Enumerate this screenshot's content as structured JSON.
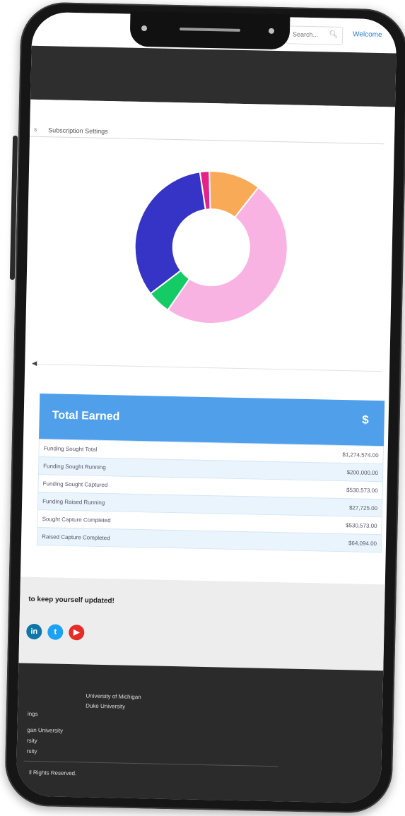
{
  "header": {
    "search_placeholder": "Search...",
    "welcome": "Welcome"
  },
  "tabs": {
    "previous_fragment": "s",
    "subscription_settings": "Subscription Settings"
  },
  "chart_data": {
    "type": "pie",
    "labels": [],
    "values": [
      2,
      11,
      49,
      5,
      33
    ],
    "colors": [
      "#e5218a",
      "#f8aa57",
      "#f9b3e3",
      "#14cb65",
      "#3634c7"
    ]
  },
  "total_earned": {
    "title": "Total Earned",
    "symbol": "$",
    "rows": [
      {
        "label": "Funding Sought Total",
        "value": "$1,274,574.00"
      },
      {
        "label": "Funding Sought Running",
        "value": "$200,000.00"
      },
      {
        "label": "Funding Sought Captured",
        "value": "$530,573.00"
      },
      {
        "label": "Funding Raised Running",
        "value": "$27,725.00"
      },
      {
        "label": "Sought Capture Completed",
        "value": "$530,573.00"
      },
      {
        "label": "Raised Capture Completed",
        "value": "$64,094.00"
      }
    ],
    "expand_icon": "chevron-down-icon"
  },
  "newsletter": {
    "text": "to keep yourself updated!",
    "social": [
      {
        "name": "linkedin-icon",
        "glyph": "in",
        "color": "#0e76a8"
      },
      {
        "name": "twitter-icon",
        "glyph": "t",
        "color": "#1da1f2"
      },
      {
        "name": "youtube-icon",
        "glyph": "▶",
        "color": "#e52d27"
      }
    ]
  },
  "footer": {
    "col_a": [
      "ings",
      "",
      "gan University",
      "rsity",
      "rsity"
    ],
    "col_b": [
      "University of Michigan",
      "Duke University"
    ],
    "copyright": "ll Rights Reserved."
  }
}
